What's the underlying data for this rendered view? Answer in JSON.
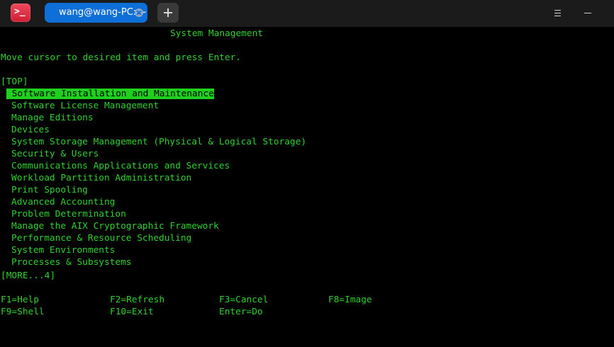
{
  "titlebar": {
    "app_icon_glyph": ">_",
    "tab_title": "wang@wang-PC: ~",
    "new_tab_icon": "plus-icon",
    "menu_icon": "hamburger-menu-icon",
    "minimize_icon": "minimize-icon"
  },
  "terminal": {
    "screen_title": "System Management",
    "instruction": "Move cursor to desired item and press Enter.",
    "top_marker": "[TOP]",
    "items": [
      "Software Installation and Maintenance",
      "Software License Management",
      "Manage Editions",
      "Devices",
      "System Storage Management (Physical & Logical Storage)",
      "Security & Users",
      "Communications Applications and Services",
      "Workload Partition Administration",
      "Print Spooling",
      "Advanced Accounting",
      "Problem Determination",
      "Manage the AIX Cryptographic Framework",
      "Performance & Resource Scheduling",
      "System Environments",
      "Processes & Subsystems"
    ],
    "selected_index": 0,
    "more_marker": "[MORE...4]",
    "function_keys": {
      "f1": "F1=Help",
      "f2": "F2=Refresh",
      "f3": "F3=Cancel",
      "f8": "F8=Image",
      "f9": "F9=Shell",
      "f10": "F10=Exit",
      "enter": "Enter=Do"
    }
  },
  "colors": {
    "terminal_text": "#2fd02f",
    "highlight_bg": "#1fd01f",
    "tab_active": "#0f6fd8",
    "app_icon": "#e0283d",
    "titlebar_bg": "#1b1b1b"
  }
}
